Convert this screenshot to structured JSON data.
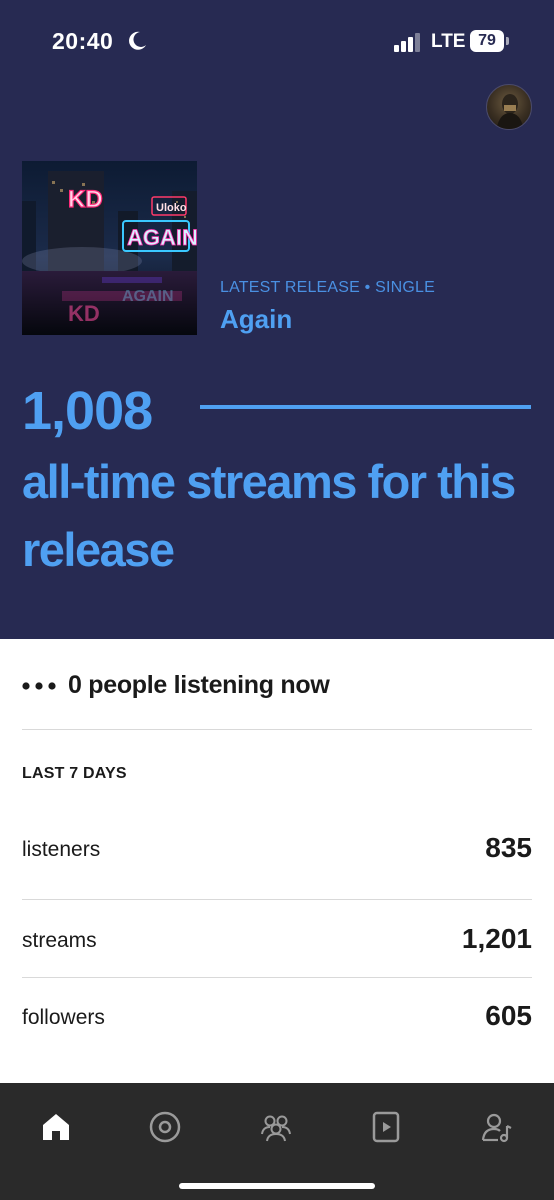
{
  "status_bar": {
    "time": "20:40",
    "network": "LTE",
    "battery": "79"
  },
  "release": {
    "kicker": "LATEST RELEASE • SINGLE",
    "title": "Again",
    "cover_text": {
      "left_sign": "KD",
      "right_sign": "AGAIN",
      "small_sign": "Uloko"
    }
  },
  "streams": {
    "count": "1,008",
    "caption": "all-time streams for this release"
  },
  "live": {
    "text": "0 people listening now"
  },
  "last7": {
    "label": "LAST 7 DAYS",
    "stats": [
      {
        "label": "listeners",
        "value": "835"
      },
      {
        "label": "streams",
        "value": "1,201"
      },
      {
        "label": "followers",
        "value": "605"
      }
    ]
  },
  "tab_bar": {
    "tabs": [
      {
        "icon": "home-icon",
        "active": true
      },
      {
        "icon": "disc-icon",
        "active": false
      },
      {
        "icon": "audience-icon",
        "active": false
      },
      {
        "icon": "video-icon",
        "active": false
      },
      {
        "icon": "profile-music-icon",
        "active": false
      }
    ]
  },
  "colors": {
    "hero_bg": "#272a52",
    "accent": "#4fa0f2",
    "tab_bar_bg": "#2a2a2a"
  }
}
